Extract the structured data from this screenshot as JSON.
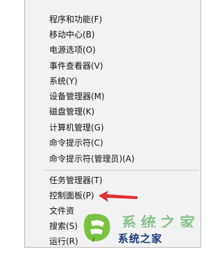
{
  "menu": {
    "items": [
      {
        "label": "程序和功能(F)"
      },
      {
        "label": "移动中心(B)"
      },
      {
        "label": "电源选项(O)"
      },
      {
        "label": "事件查看器(V)"
      },
      {
        "label": "系统(Y)"
      },
      {
        "label": "设备管理器(M)"
      },
      {
        "label": "磁盘管理(K)"
      },
      {
        "label": "计算机管理(G)"
      },
      {
        "label": "命令提示符(C)"
      },
      {
        "label": "命令提示符(管理员)(A)"
      },
      {
        "label": "任务管理器(T)"
      },
      {
        "label": "控制面板(P)"
      },
      {
        "label": "文件资"
      },
      {
        "label": "搜索(S)"
      },
      {
        "label": "运行(R)"
      }
    ]
  },
  "watermark": {
    "text": "系统之家",
    "ghost_text": "系统之家"
  },
  "colors": {
    "menu_background": "#f2f2f2",
    "arrow": "#e03030",
    "watermark_green": "#7cc242"
  }
}
